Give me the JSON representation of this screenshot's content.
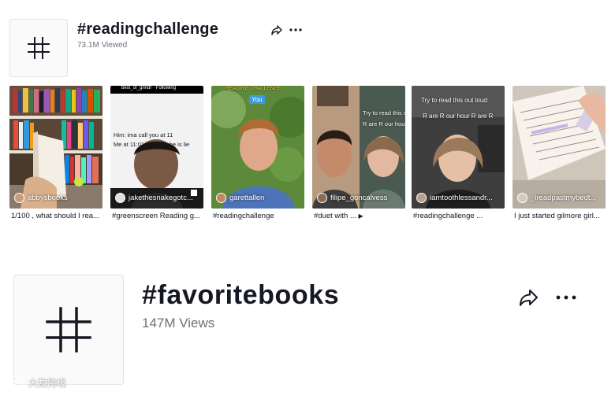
{
  "hashtag_1": {
    "title": "#readingchallenge",
    "views": "73.1M Viewed",
    "share_icon": "share-icon",
    "more_icon": "more-icon",
    "videos": [
      {
        "username": "abbysbooks",
        "caption": "1/100 , what should I rea..."
      },
      {
        "username": "jakethesnakegotc...",
        "caption": "#greenscreen Reading g...",
        "overlay_top": "best_of_grindr · Following",
        "overlay_1": "Him: ima call you at 11",
        "overlay_2": "Me at 11:01 knowing he is lie"
      },
      {
        "username": "garettallen",
        "caption": "#readingchallenge",
        "overlay_banner": "READING CHALLENGE",
        "overlay_badge": "You"
      },
      {
        "username": "filipe_goncalvess",
        "caption": "#duet with ...",
        "overlay_1": "Try to read this ou",
        "overlay_2": "R are R our hour R"
      },
      {
        "username": "iamtoothlessandr...",
        "caption": "#readingchallenge ...",
        "overlay_1": "Try to read this out loud:",
        "overlay_2": "R are R our hour R are R"
      },
      {
        "username": "_ireadpastmybedt...",
        "caption": "I just started gilmore girl..."
      }
    ]
  },
  "hashtag_2": {
    "title": "#favoritebooks",
    "views": "147M Views",
    "share_icon": "share-icon",
    "more_icon": "more-icon"
  },
  "watermark": {
    "text": "大数跨境"
  }
}
